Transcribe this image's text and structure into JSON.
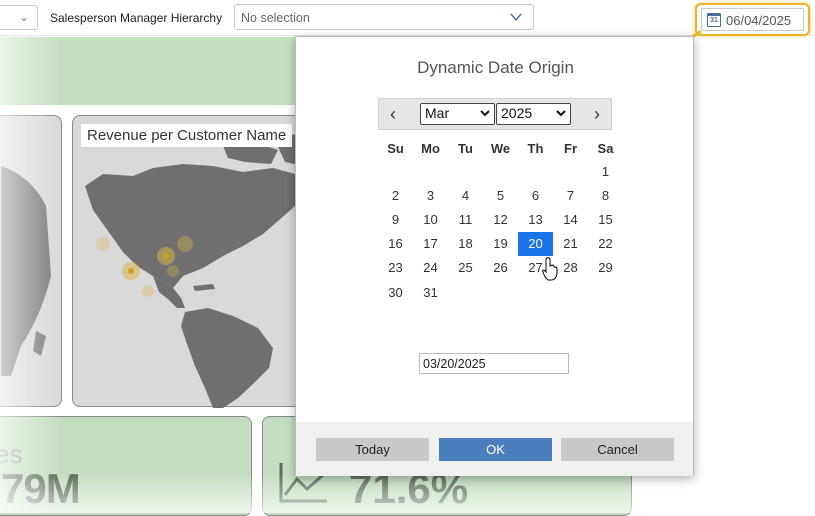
{
  "topbar": {
    "filter_label": "Salesperson Manager Hierarchy",
    "filter_value": "No selection",
    "date_value": "06/04/2025"
  },
  "dashboard": {
    "map_title": "Revenue per Customer Name",
    "kpi1_label": "es",
    "kpi1_value": "79M",
    "kpi2_value": "71.6%"
  },
  "dialog": {
    "title": "Dynamic Date Origin",
    "month": "Mar",
    "year": "2025",
    "weekdays": [
      "Su",
      "Mo",
      "Tu",
      "We",
      "Th",
      "Fr",
      "Sa"
    ],
    "weeks": [
      [
        "",
        "",
        "",
        "",
        "",
        "",
        "1"
      ],
      [
        "2",
        "3",
        "4",
        "5",
        "6",
        "7",
        "8"
      ],
      [
        "9",
        "10",
        "11",
        "12",
        "13",
        "14",
        "15"
      ],
      [
        "16",
        "17",
        "18",
        "19",
        "20",
        "21",
        "22"
      ],
      [
        "23",
        "24",
        "25",
        "26",
        "27",
        "28",
        "29"
      ],
      [
        "30",
        "31",
        "",
        "",
        "",
        "",
        ""
      ]
    ],
    "selected_day": "20",
    "date_input": "03/20/2025",
    "today_label": "Today",
    "ok_label": "OK",
    "cancel_label": "Cancel"
  },
  "colors": {
    "accent": "#1a73e8",
    "ok_button": "#4a7ebf",
    "highlight": "#f0b323",
    "dashboard_green": "#c4dfc0"
  },
  "icons": {
    "date_chip": "calendar-icon",
    "prev": "chevron-left-icon",
    "next": "chevron-right-icon"
  }
}
